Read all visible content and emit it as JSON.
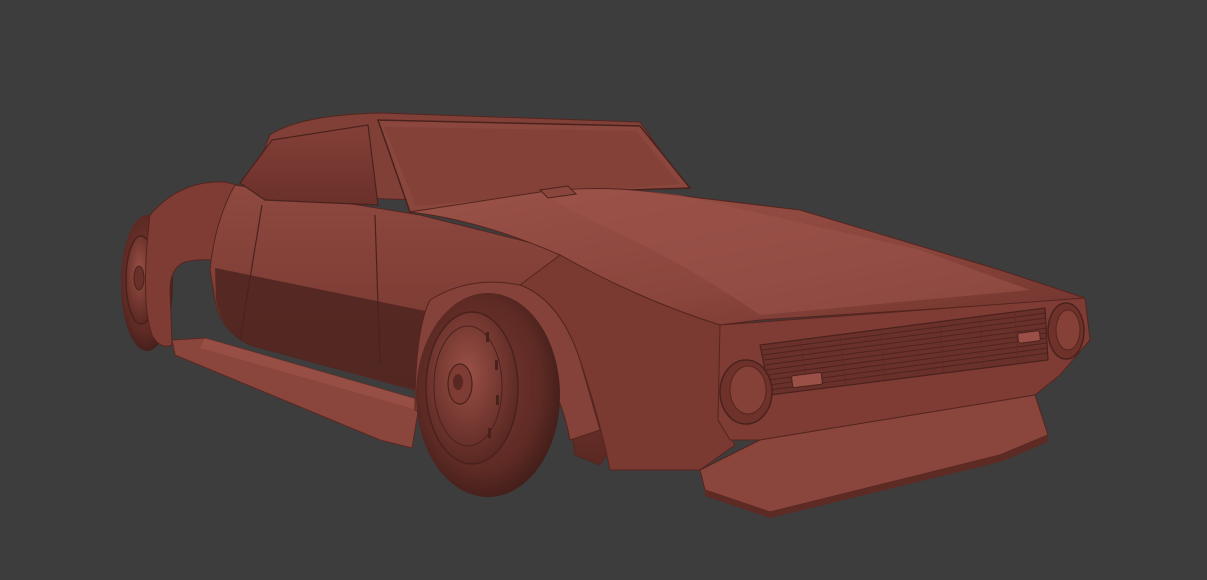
{
  "viewport": {
    "background_color": "#3d3d3d",
    "model_color": "#7a3a32",
    "highlight_color": "#9a4e44",
    "shadow_color": "#3e1c18"
  },
  "scene": {
    "object": "car-model",
    "shading": "solid",
    "visible_parts": [
      "body",
      "hood",
      "windshield",
      "roof",
      "front-grille",
      "headlights",
      "front-splitter",
      "side-skirt",
      "wheel-arches",
      "front-wheel",
      "rear-wheel"
    ]
  }
}
